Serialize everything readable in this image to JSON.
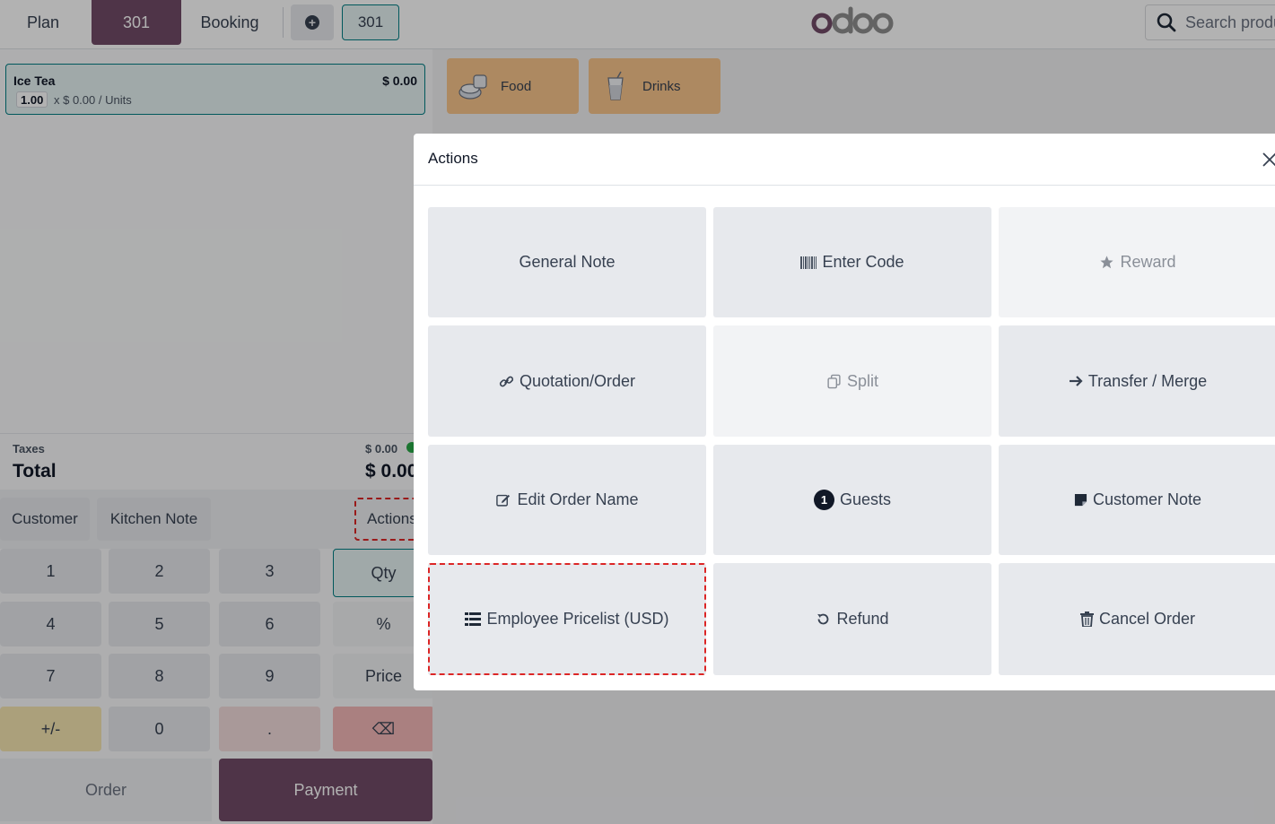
{
  "navbar": {
    "plan_label": "Plan",
    "table_label": "301",
    "booking_label": "Booking",
    "order_tab_label": "301",
    "search_placeholder": "Search products..."
  },
  "order": {
    "lines": [
      {
        "name": "Ice Tea",
        "price": "$ 0.00",
        "qty": "1.00",
        "unit_text": "x $ 0.00 / Units"
      }
    ],
    "taxes_label": "Taxes",
    "taxes_value": "$ 0.00",
    "total_label": "Total",
    "total_value": "$ 0.00"
  },
  "controls": {
    "customer_label": "Customer",
    "kitchen_note_label": "Kitchen Note",
    "actions_label": "Actions"
  },
  "numpad": {
    "keys": [
      "1",
      "2",
      "3",
      "4",
      "5",
      "6",
      "7",
      "8",
      "9",
      "+/-",
      "0",
      "."
    ],
    "qty_label": "Qty",
    "percent_label": "%",
    "price_label": "Price",
    "backspace_label": "⌫"
  },
  "footer": {
    "order_label": "Order",
    "payment_label": "Payment"
  },
  "categories": [
    {
      "label": "Food",
      "icon": "food-icon"
    },
    {
      "label": "Drinks",
      "icon": "drink-icon"
    }
  ],
  "modal": {
    "title": "Actions",
    "actions": [
      {
        "label": "General Note",
        "icon": "",
        "disabled": false,
        "highlighted": false
      },
      {
        "label": "Enter Code",
        "icon": "barcode-icon",
        "disabled": false,
        "highlighted": false
      },
      {
        "label": "Reward",
        "icon": "star-icon",
        "disabled": true,
        "highlighted": false
      },
      {
        "label": "Quotation/Order",
        "icon": "link-icon",
        "disabled": false,
        "highlighted": false
      },
      {
        "label": "Split",
        "icon": "copy-icon",
        "disabled": true,
        "highlighted": false
      },
      {
        "label": "Transfer / Merge",
        "icon": "arrow-right-icon",
        "disabled": false,
        "highlighted": false
      },
      {
        "label": "Edit Order Name",
        "icon": "edit-icon",
        "disabled": false,
        "highlighted": false
      },
      {
        "label": "Guests",
        "icon": "guest-count-badge",
        "badge": "1",
        "disabled": false,
        "highlighted": false
      },
      {
        "label": "Customer Note",
        "icon": "sticky-note-icon",
        "disabled": false,
        "highlighted": false
      },
      {
        "label": "Employee Pricelist (USD)",
        "icon": "list-icon",
        "disabled": false,
        "highlighted": true
      },
      {
        "label": "Refund",
        "icon": "undo-icon",
        "disabled": false,
        "highlighted": false
      },
      {
        "label": "Cancel Order",
        "icon": "trash-icon",
        "disabled": false,
        "highlighted": false
      }
    ]
  },
  "colors": {
    "brand": "#714b67",
    "accent": "#017e84",
    "category_bg": "#f8c48c",
    "highlight_outline": "#dc2626"
  }
}
